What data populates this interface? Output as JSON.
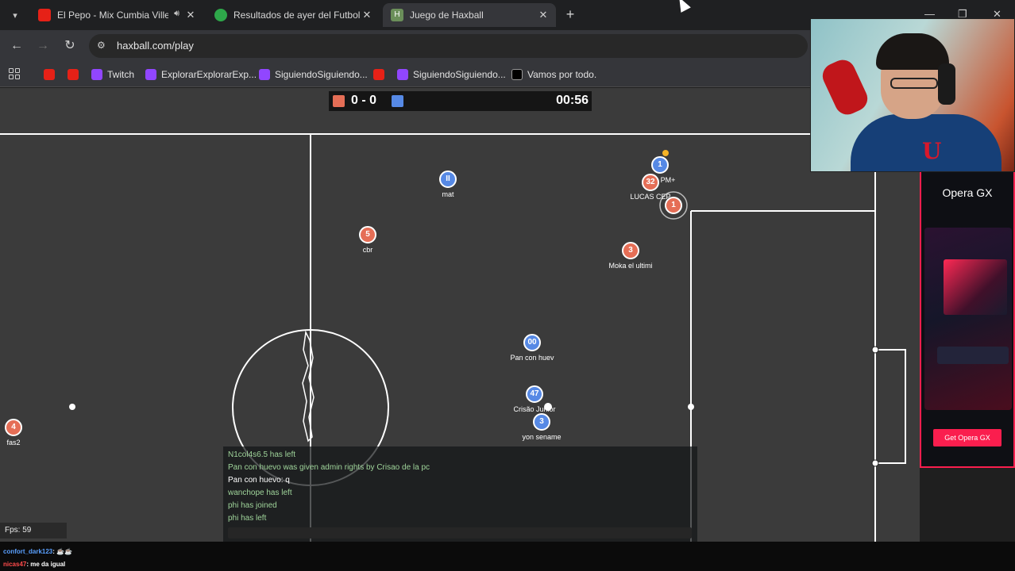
{
  "tabs": [
    {
      "label": "El Pepo - Mix Cumbia Villera",
      "active": false,
      "icon": "youtube-icon",
      "audio": true
    },
    {
      "label": "Resultados de ayer del Futbol A",
      "active": false,
      "icon": "ball-icon"
    },
    {
      "label": "Juego de Haxball",
      "active": true,
      "icon": "haxball-icon"
    }
  ],
  "window_controls": [
    "minimize",
    "restore",
    "close"
  ],
  "address": {
    "url": "haxball.com/play"
  },
  "bookmarks": [
    {
      "label": "",
      "icon": "youtube-icon"
    },
    {
      "label": "",
      "icon": "youtube-icon"
    },
    {
      "label": "Twitch",
      "icon": "twitch-icon"
    },
    {
      "label": "ExplorarExplorarExp...",
      "icon": "twitch-icon"
    },
    {
      "label": "SiguiendoSiguiendo...",
      "icon": "twitch-icon"
    },
    {
      "label": "",
      "icon": "youtube-icon"
    },
    {
      "label": "SiguiendoSiguiendo...",
      "icon": "twitch-icon"
    },
    {
      "label": "Vamos por todo.",
      "icon": "x-icon"
    }
  ],
  "scoreboard": {
    "score": "0 - 0",
    "time": "00:56",
    "red_color": "#e56e56",
    "blue_color": "#5689e5"
  },
  "players": [
    {
      "number": "II",
      "name": "mat",
      "team": "blue"
    },
    {
      "number": "1",
      "name": "PM+",
      "team": "blue"
    },
    {
      "number": "32",
      "name": "LUCAS CEP",
      "team": "red"
    },
    {
      "number": "1",
      "name": "",
      "team": "red"
    },
    {
      "number": "5",
      "name": "cbr",
      "team": "red"
    },
    {
      "number": "3",
      "name": "Moka el ultimi",
      "team": "red"
    },
    {
      "number": "00",
      "name": "Pan con huev",
      "team": "blue"
    },
    {
      "number": "47",
      "name": "Crisão Junior",
      "team": "blue"
    },
    {
      "number": "3",
      "name": "yon sename",
      "team": "blue"
    },
    {
      "number": "4",
      "name": "fas2",
      "team": "red"
    }
  ],
  "chat": [
    {
      "text": "N1col4s6.5 has left",
      "type": "sys"
    },
    {
      "text": "Pan con huevo was given admin rights by Crisao de la pc",
      "type": "sys"
    },
    {
      "text": "Pan con huevo: q",
      "type": "msg"
    },
    {
      "text": "wanchope has left",
      "type": "sys"
    },
    {
      "text": "phi has joined",
      "type": "sys"
    },
    {
      "text": "phi has left",
      "type": "sys"
    }
  ],
  "fps": "Fps: 59",
  "ad": {
    "brand": "Opera GX",
    "cta": "Get Opera GX",
    "accent": "#fa1e4e"
  },
  "stream_chat": [
    {
      "user": "confort_dark123",
      "text": ": ☕☕"
    },
    {
      "user": "nicas47",
      "text": ": me da igual"
    }
  ]
}
